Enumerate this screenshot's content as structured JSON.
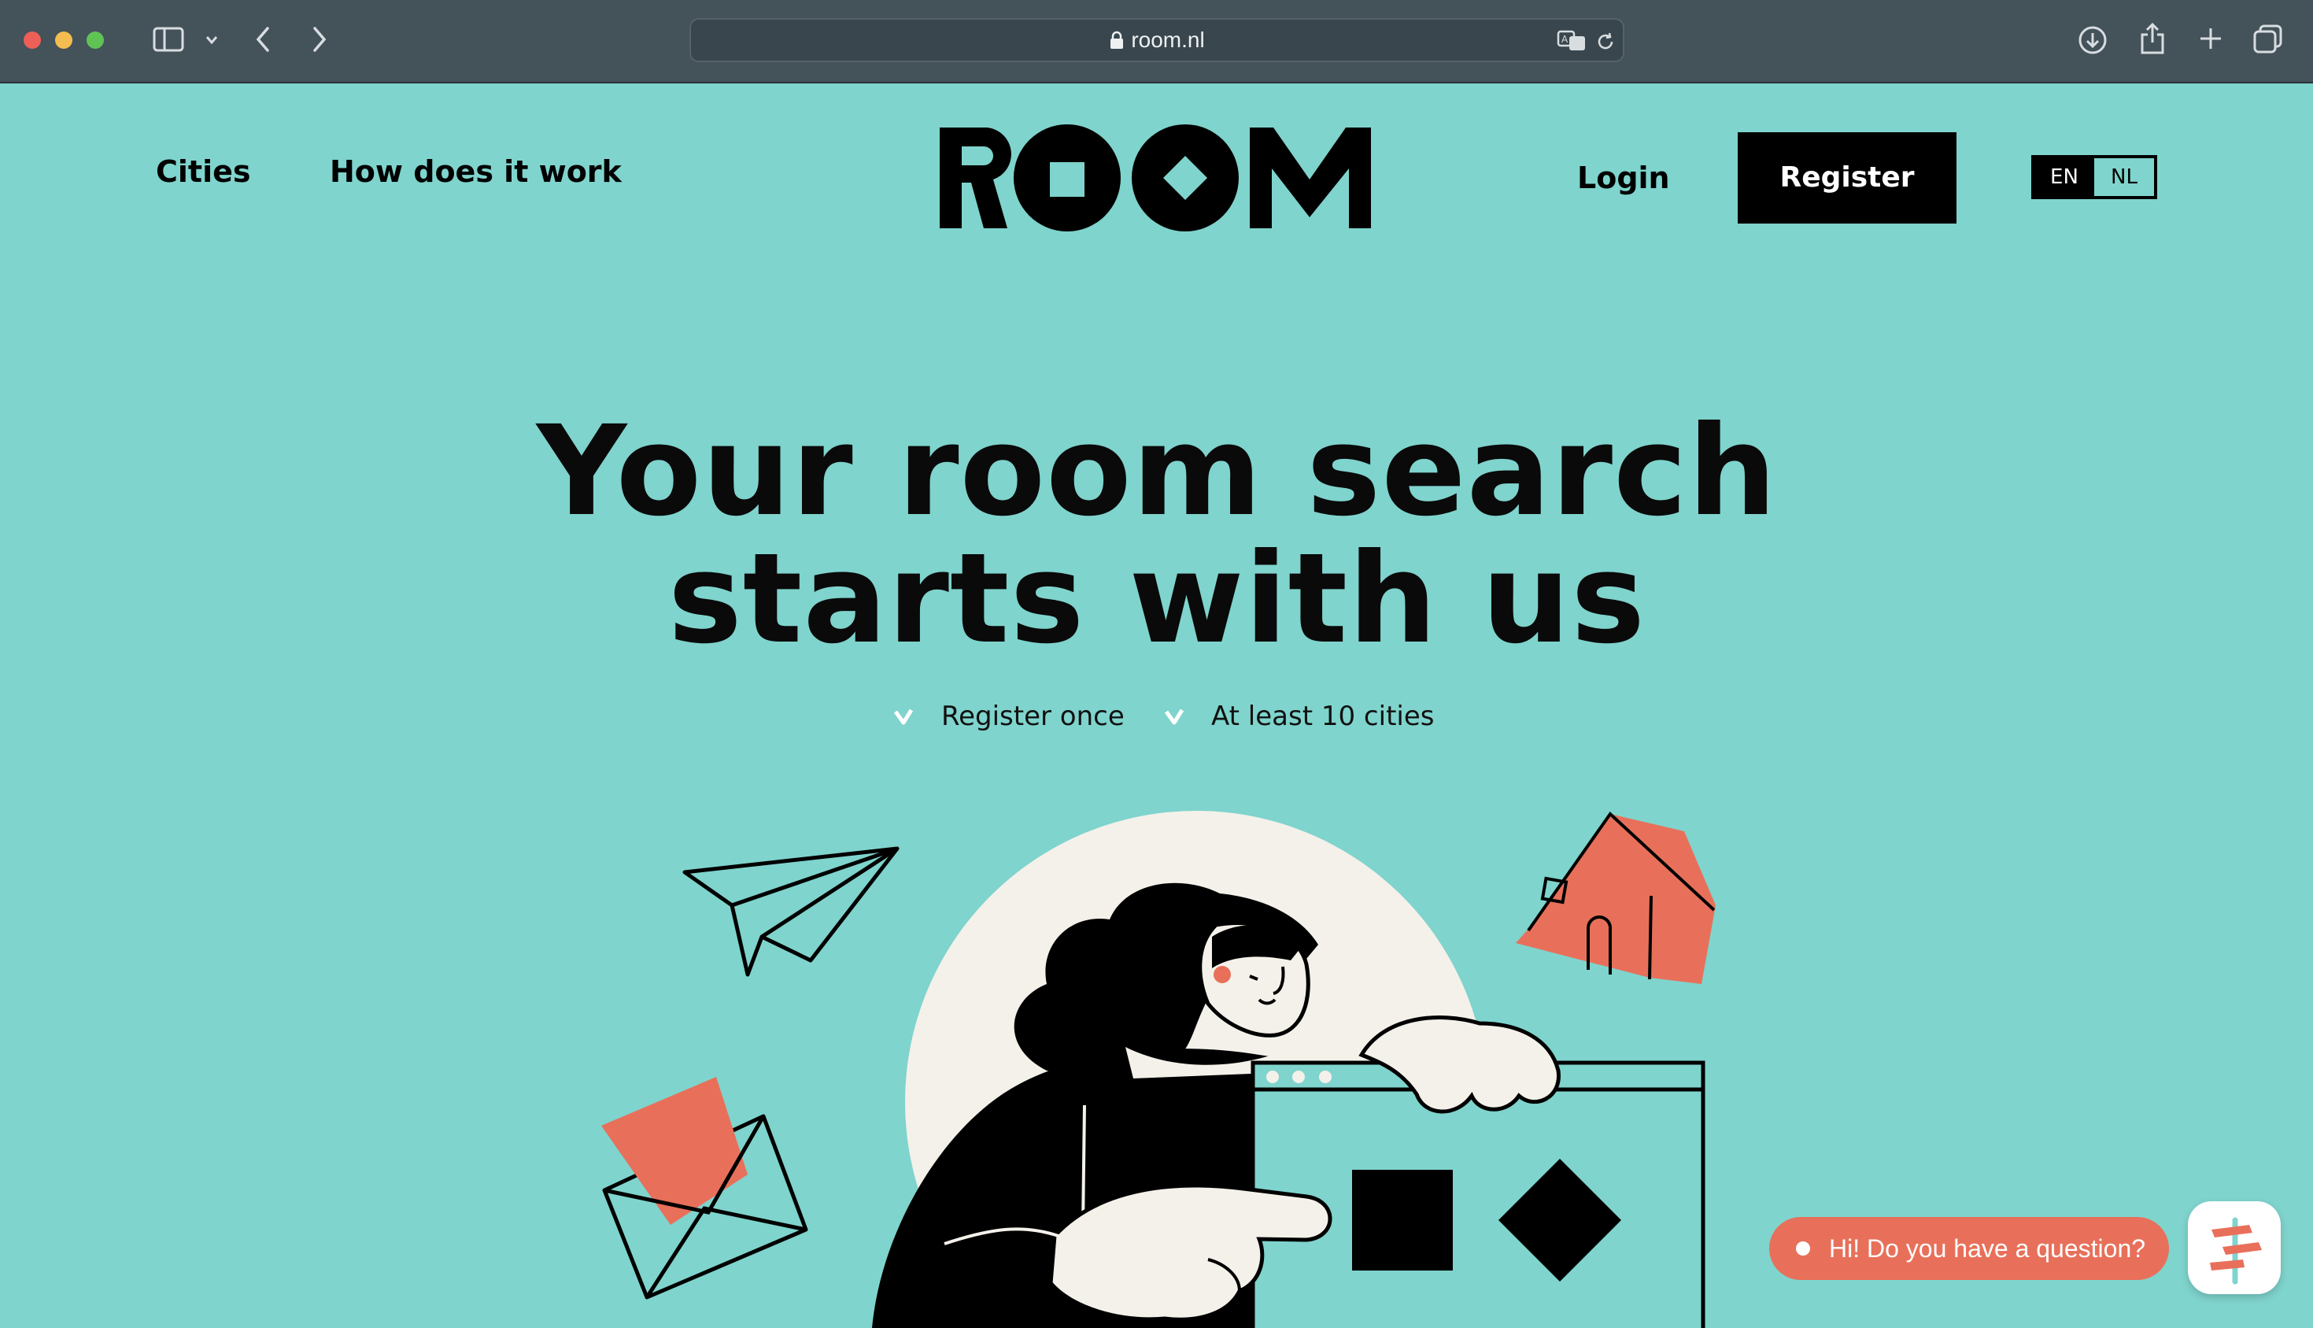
{
  "browser": {
    "url": "room.nl",
    "icons": [
      "sidebar-icon",
      "chevron-down-icon",
      "back-icon",
      "forward-icon",
      "lock-icon",
      "translate-icon",
      "reload-icon",
      "download-icon",
      "share-icon",
      "new-tab-icon",
      "tabs-overview-icon"
    ]
  },
  "nav": {
    "cities": "Cities",
    "how": "How does it work",
    "login": "Login",
    "register": "Register",
    "lang_en": "EN",
    "lang_nl": "NL"
  },
  "hero": {
    "title_line1": "Your room search",
    "title_line2": "starts with us",
    "feature1": "Register once",
    "feature2": "At least 10 cities"
  },
  "chat": {
    "message": "Hi! Do you have a question?"
  },
  "colors": {
    "background": "#7fd4cd",
    "accent": "#e8705a",
    "cream": "#f4f1ea",
    "black": "#000000"
  }
}
